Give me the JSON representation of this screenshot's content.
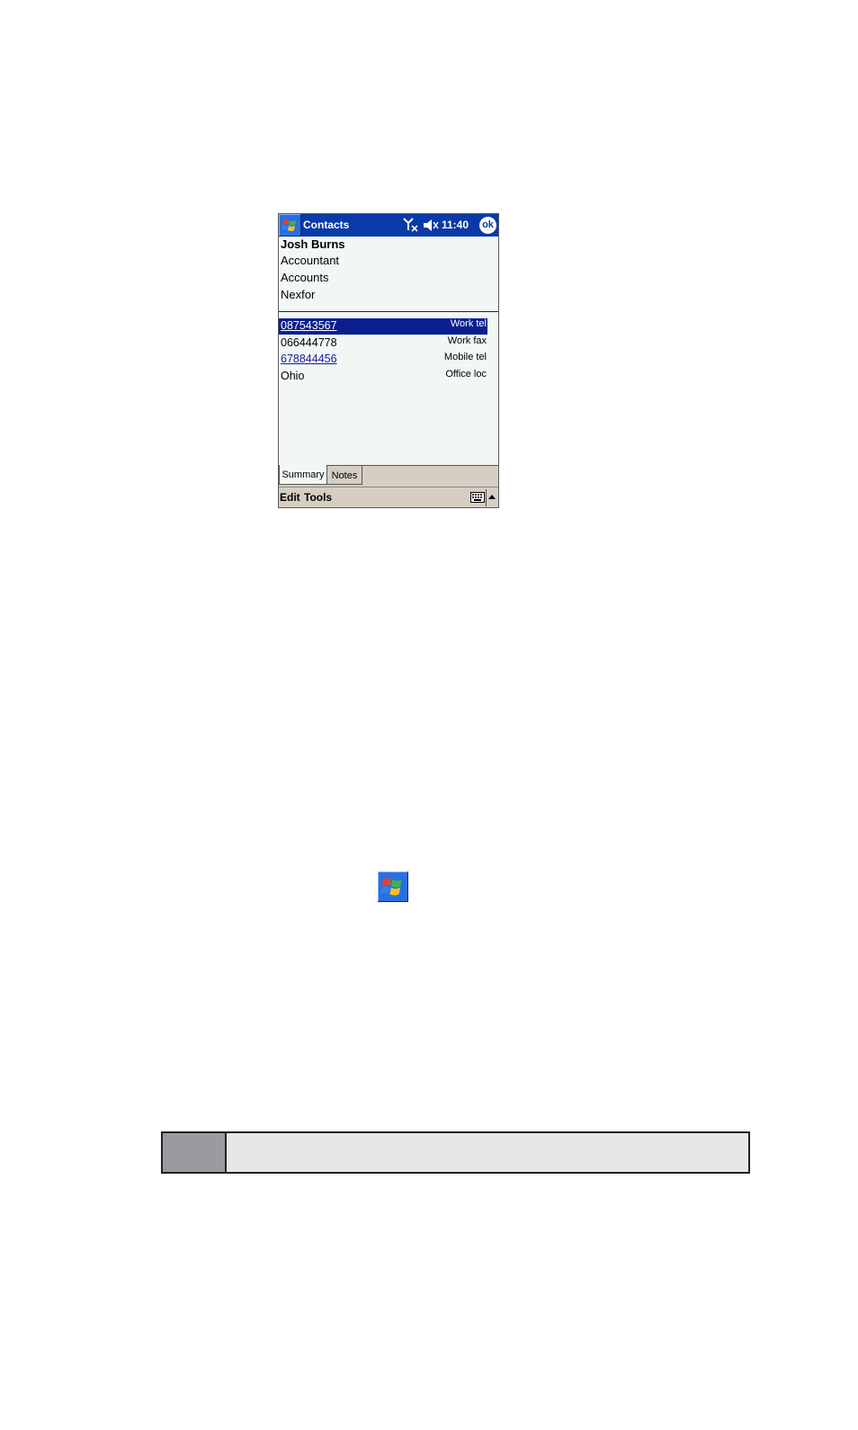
{
  "titlebar": {
    "app_title": "Contacts",
    "clock": "11:40",
    "ok_label": "ok"
  },
  "contact": {
    "name": "Josh Burns",
    "job_title": "Accountant",
    "department": "Accounts",
    "company": "Nexfor"
  },
  "details": [
    {
      "value": "087543567",
      "label": "Work tel",
      "link": true,
      "selected": true
    },
    {
      "value": "066444778",
      "label": "Work fax",
      "link": false,
      "selected": false
    },
    {
      "value": "678844456",
      "label": "Mobile tel",
      "link": true,
      "selected": false
    },
    {
      "value": "Ohio",
      "label": "Office loc",
      "link": false,
      "selected": false
    }
  ],
  "tabs": [
    {
      "label": "Summary",
      "active": true
    },
    {
      "label": "Notes",
      "active": false
    }
  ],
  "menubar": {
    "edit": "Edit",
    "tools": "Tools"
  },
  "icons": {
    "start": "windows-flag-icon",
    "signal": "antenna-no-signal-icon",
    "volume": "speaker-muted-icon",
    "keyboard": "keyboard-icon",
    "sip": "sip-arrow-up-icon"
  },
  "colors": {
    "titlebar": "#0a3aa8",
    "selection": "#0a1f8f",
    "link": "#1a1a9a",
    "chrome": "#d6cec2"
  }
}
